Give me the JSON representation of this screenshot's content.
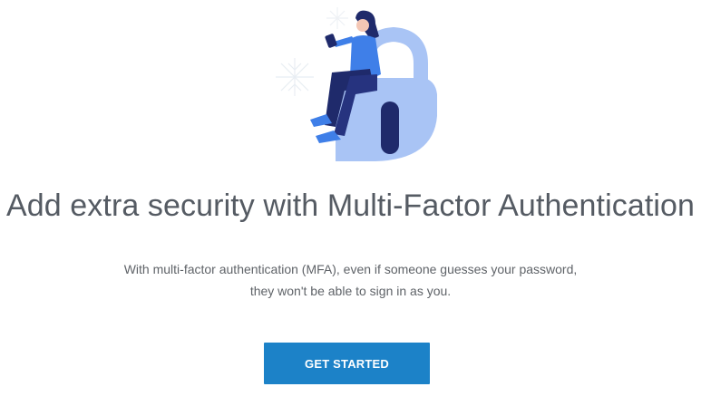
{
  "hero": {
    "illustration_icon": "person-sitting-on-padlock-illustration"
  },
  "content": {
    "title": "Add extra security with Multi-Factor Authentication",
    "description_line1": "With multi-factor authentication (MFA), even if someone guesses your password,",
    "description_line2": "they won't be able to sign in as you."
  },
  "actions": {
    "get_started_label": "GET STARTED"
  },
  "colors": {
    "button_background": "#1c82c8",
    "button_text": "#ffffff",
    "heading_text": "#555b63",
    "body_text": "#5f6368",
    "lock_light": "#a9c4f5",
    "lock_dark": "#1f2a6b",
    "person_blue": "#3f7fe8"
  }
}
